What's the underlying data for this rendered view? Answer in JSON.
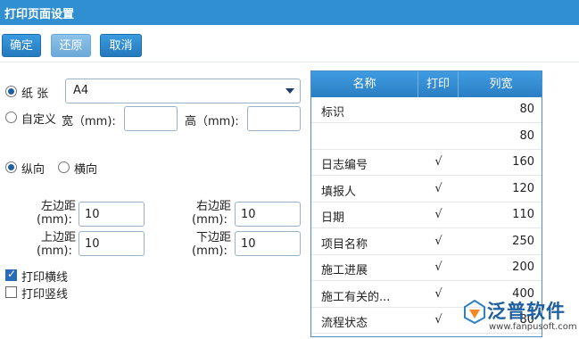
{
  "window": {
    "title": "打印页面设置"
  },
  "toolbar": {
    "confirm_label": "确定",
    "restore_label": "还原",
    "cancel_label": "取消"
  },
  "paper": {
    "paper_label": "纸 张",
    "paper_value": "A4",
    "custom_label": "自定义",
    "width_label": "宽（mm):",
    "height_label": "高（mm):",
    "width_value": "",
    "height_value": ""
  },
  "orientation": {
    "portrait_label": "纵向",
    "landscape_label": "横向"
  },
  "margins": {
    "left_label_1": "左边距",
    "left_label_2": "(mm):",
    "left_value": "10",
    "right_label_1": "右边距",
    "right_label_2": "(mm):",
    "right_value": "10",
    "top_label_1": "上边距",
    "top_label_2": "(mm):",
    "top_value": "10",
    "bottom_label_1": "下边距",
    "bottom_label_2": "(mm):",
    "bottom_value": "10"
  },
  "options": {
    "print_hlines_label": "打印横线",
    "print_vlines_label": "打印竖线"
  },
  "grid": {
    "headers": [
      "名称",
      "打印",
      "列宽"
    ],
    "rows": [
      {
        "name": "标识",
        "print": "",
        "width": "80"
      },
      {
        "name": "",
        "print": "",
        "width": "80"
      },
      {
        "name": "日志编号",
        "print": "√",
        "width": "160"
      },
      {
        "name": "填报人",
        "print": "√",
        "width": "120"
      },
      {
        "name": "日期",
        "print": "√",
        "width": "110"
      },
      {
        "name": "项目名称",
        "print": "√",
        "width": "250"
      },
      {
        "name": "施工进展",
        "print": "√",
        "width": "200"
      },
      {
        "name": "施工有关的...",
        "print": "√",
        "width": "400"
      },
      {
        "name": "流程状态",
        "print": "√",
        "width": "80"
      }
    ]
  },
  "logo": {
    "brand": "泛普软件",
    "url": "www.fanpusoft.com"
  },
  "colors": {
    "titlebar": "#2f8fd0",
    "button": "#2479bd",
    "grid_header": "#2b7fc4"
  }
}
